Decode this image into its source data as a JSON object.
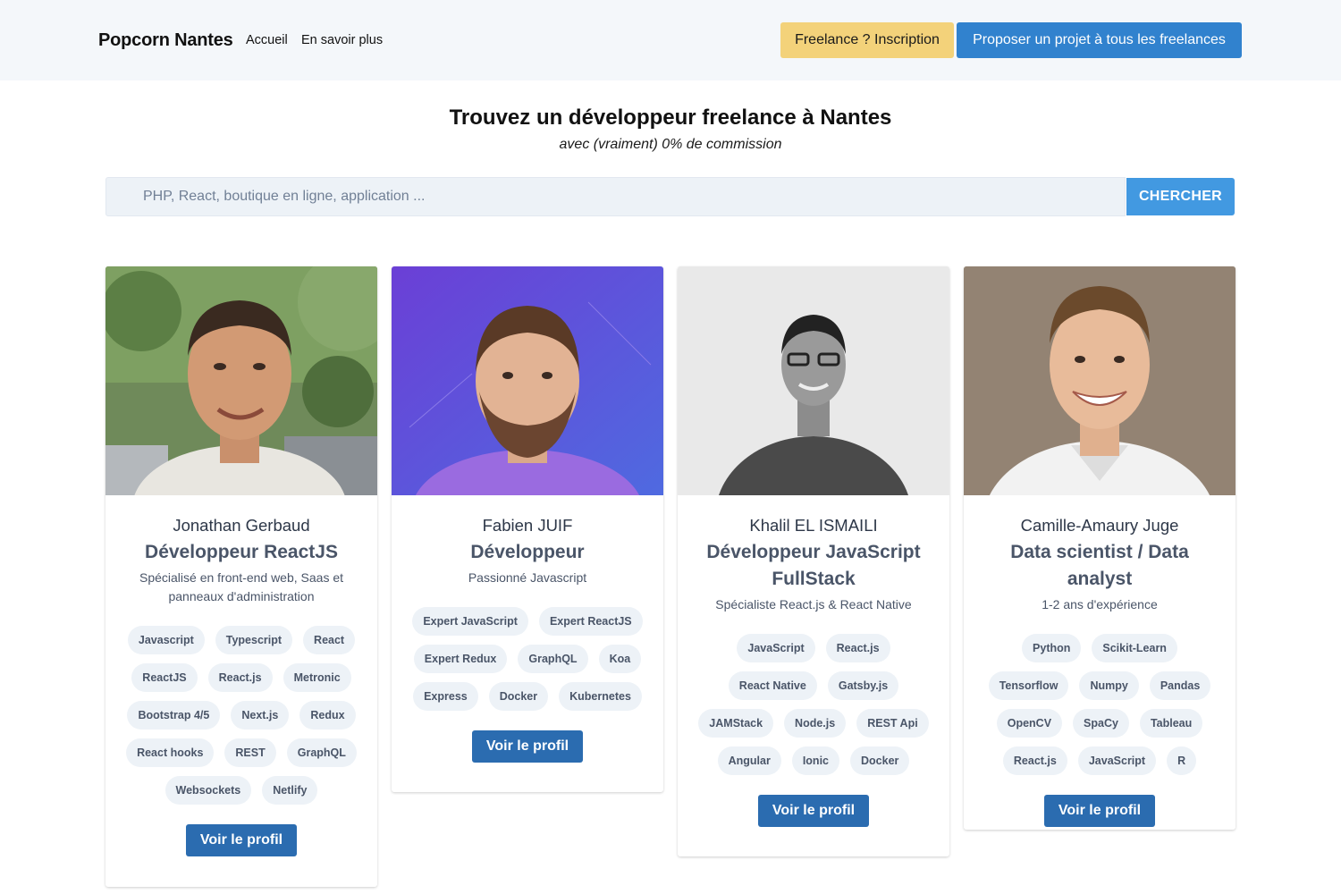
{
  "header": {
    "brand": "Popcorn Nantes",
    "nav": [
      "Accueil",
      "En savoir plus"
    ],
    "freelance_button": "Freelance ? Inscription",
    "propose_button": "Proposer un projet à tous les freelances"
  },
  "hero": {
    "title": "Trouvez un développeur freelance à Nantes",
    "subtitle": "avec (vraiment) 0% de commission"
  },
  "search": {
    "placeholder": "PHP, React, boutique en ligne, application ...",
    "button": "CHERCHER"
  },
  "cards": [
    {
      "name": "Jonathan Gerbaud",
      "role": "Développeur ReactJS",
      "desc": "Spécialisé en front-end web, Saas et panneaux d'administration",
      "tags": [
        "Javascript",
        "Typescript",
        "React",
        "ReactJS",
        "React.js",
        "Metronic",
        "Bootstrap 4/5",
        "Next.js",
        "Redux",
        "React hooks",
        "REST",
        "GraphQL",
        "Websockets",
        "Netlify"
      ],
      "button": "Voir le profil"
    },
    {
      "name": "Fabien JUIF",
      "role": "Développeur",
      "desc": "Passionné Javascript",
      "tags": [
        "Expert JavaScript",
        "Expert ReactJS",
        "Expert Redux",
        "GraphQL",
        "Koa",
        "Express",
        "Docker",
        "Kubernetes"
      ],
      "button": "Voir le profil"
    },
    {
      "name": "Khalil EL ISMAILI",
      "role": "Développeur JavaScript FullStack",
      "desc": "Spécialiste React.js & React Native",
      "tags": [
        "JavaScript",
        "React.js",
        "React Native",
        "Gatsby.js",
        "JAMStack",
        "Node.js",
        "REST Api",
        "Angular",
        "Ionic",
        "Docker"
      ],
      "button": "Voir le profil"
    },
    {
      "name": "Camille-Amaury Juge",
      "role": "Data scientist / Data analyst",
      "desc": "1-2 ans d'expérience",
      "tags": [
        "Python",
        "Scikit-Learn",
        "Tensorflow",
        "Numpy",
        "Pandas",
        "OpenCV",
        "SpaCy",
        "Tableau",
        "React.js",
        "JavaScript",
        "R"
      ],
      "button": "Voir le profil"
    }
  ]
}
